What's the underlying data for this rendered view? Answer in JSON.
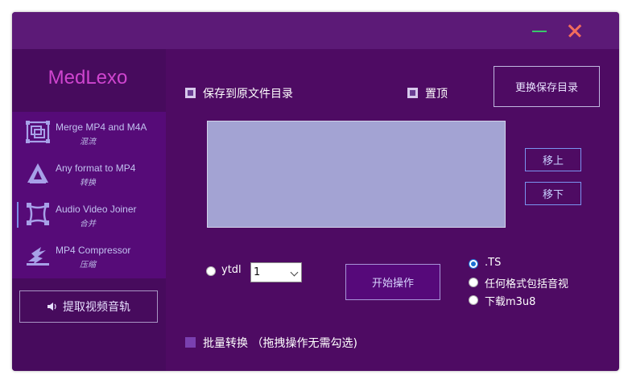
{
  "app": {
    "brand": "MedLexo"
  },
  "colors": {
    "window_bg": "#4e0b63",
    "titlebar": "#5c1a77",
    "sidebar": "#470b5d",
    "nav_bg": "#560b78",
    "brand": "#cf45cf",
    "minimize": "#39c86a",
    "close": "#f26d5c",
    "listbox": "#a3a3d3"
  },
  "sidebar": {
    "items": [
      {
        "label": "Merge MP4 and M4A",
        "sublabel": "混流",
        "icon": "merge-frames-icon"
      },
      {
        "label": "Any format to MP4",
        "sublabel": "转换",
        "icon": "convert-tent-icon"
      },
      {
        "label": "Audio Video Joiner",
        "sublabel": "合并",
        "icon": "joiner-frame-icon",
        "active": true
      },
      {
        "label": "MP4 Compressor",
        "sublabel": "压缩",
        "icon": "compress-icon"
      }
    ],
    "extract_button": "提取视频音轨",
    "extract_icon": "speaker-icon"
  },
  "main": {
    "save_to_source_dir": "保存到原文件目录",
    "pin_on_top": "置顶",
    "change_save_dir_button": "更换保存目录",
    "move_up_button": "移上",
    "move_down_button": "移下",
    "ytdl_label": "ytdl",
    "threads_select_value": "1",
    "start_button": "开始操作",
    "output_options": [
      {
        "label": ".TS",
        "selected": true
      },
      {
        "label": "任何格式包括音视",
        "selected": false
      },
      {
        "label": "下载m3u8",
        "selected": false
      }
    ],
    "batch_convert": "批量转换 （拖拽操作无需勾选)"
  }
}
